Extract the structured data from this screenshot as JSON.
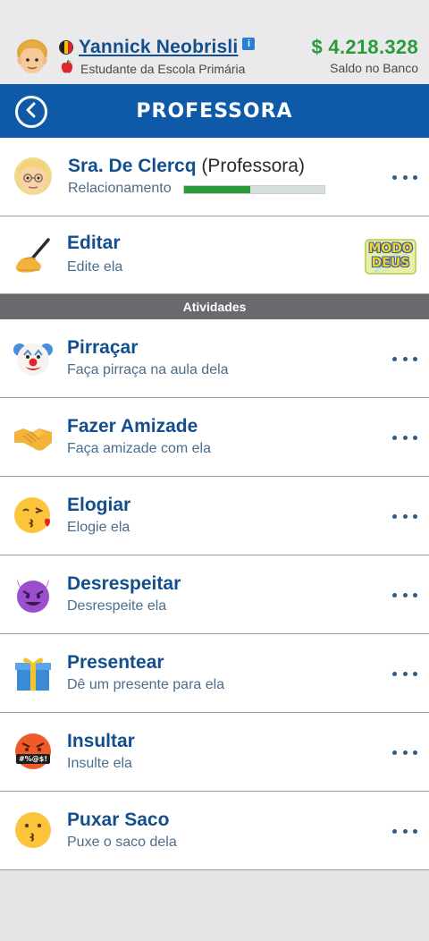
{
  "player": {
    "name": "Yannick Neobrisli",
    "status": "Estudante da Escola Primária",
    "flag_colors": [
      "#1e1e1e",
      "#f2c200",
      "#e0202b"
    ]
  },
  "bank": {
    "balance": "$ 4.218.328",
    "label": "Saldo no Banco"
  },
  "header": {
    "title": "PROFESSORA"
  },
  "teacher": {
    "name": "Sra. De Clercq",
    "role": "(Professora)",
    "relationship_label": "Relacionamento",
    "relationship_level": 0.47
  },
  "edit": {
    "title": "Editar",
    "subtitle": "Edite ela",
    "badge_line1": "MODO",
    "badge_line2": "DEUS"
  },
  "section": {
    "label": "Atividades"
  },
  "activities": [
    {
      "title": "Pirraçar",
      "subtitle": "Faça pirraça na aula dela",
      "icon": "clown-icon"
    },
    {
      "title": "Fazer Amizade",
      "subtitle": "Faça amizade com ela",
      "icon": "handshake-icon"
    },
    {
      "title": "Elogiar",
      "subtitle": "Elogie ela",
      "icon": "kiss-face-icon"
    },
    {
      "title": "Desrespeitar",
      "subtitle": "Desrespeite ela",
      "icon": "devil-face-icon"
    },
    {
      "title": "Presentear",
      "subtitle": "Dê um presente para ela",
      "icon": "gift-icon"
    },
    {
      "title": "Insultar",
      "subtitle": "Insulte ela",
      "icon": "swearing-face-icon",
      "icon_text": "#%@$!"
    },
    {
      "title": "Puxar Saco",
      "subtitle": "Puxe o saco dela",
      "icon": "kissing-face-icon"
    }
  ],
  "colors": {
    "header_blue": "#0f5aa8",
    "title_blue": "#134f8e",
    "money_green": "#2a9a3a",
    "section_gray": "#6a6a6e"
  }
}
